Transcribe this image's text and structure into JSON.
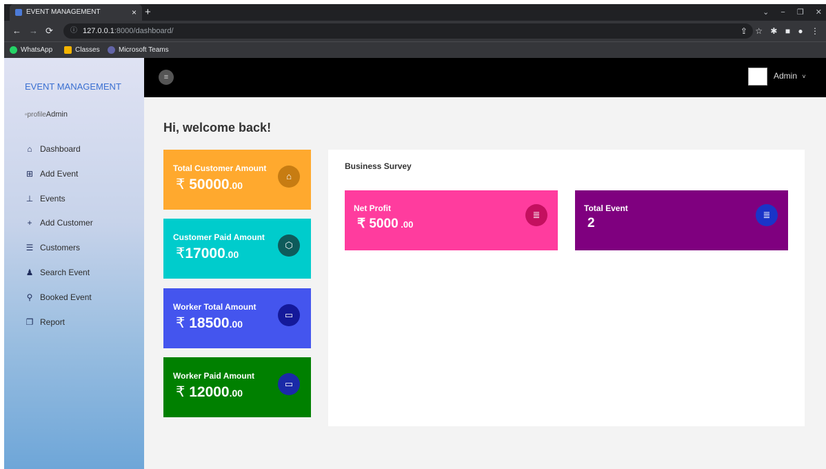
{
  "browser": {
    "tab_title": "EVENT MANAGEMENT",
    "tab_close": "×",
    "new_tab": "+",
    "url_host": "127.0.0.1",
    "url_path": ":8000/dashboard/",
    "bookmarks": [
      {
        "label": "WhatsApp",
        "icon": "whatsapp-icon",
        "color": "#25d366"
      },
      {
        "label": "Classes",
        "icon": "classroom-icon",
        "color": "#f4b400"
      },
      {
        "label": "Microsoft Teams",
        "icon": "teams-icon",
        "color": "#6264a7"
      }
    ]
  },
  "sidebar": {
    "brand": "EVENT MANAGEMENT",
    "profile_img_alt": "profile",
    "profile_name": "Admin",
    "items": [
      {
        "label": "Dashboard",
        "icon": "home-icon"
      },
      {
        "label": "Add Event",
        "icon": "plus-square-icon"
      },
      {
        "label": "Events",
        "icon": "sitemap-icon"
      },
      {
        "label": "Add Customer",
        "icon": "plus-icon"
      },
      {
        "label": "Customers",
        "icon": "tree-list-icon"
      },
      {
        "label": "Search Event",
        "icon": "user-search-icon"
      },
      {
        "label": "Booked Event",
        "icon": "bicycle-icon"
      },
      {
        "label": "Report",
        "icon": "copy-icon"
      }
    ]
  },
  "topbar": {
    "admin_label": "Admin",
    "caret": "˅"
  },
  "main": {
    "welcome": "Hi, welcome back!",
    "currency": "₹",
    "stats": [
      {
        "label": "Total Customer Amount",
        "amount": "50000",
        "decimals": ".00",
        "bg": "#ffa92e",
        "icon_bg": "#c77c12",
        "icon": "basket-icon"
      },
      {
        "label": "Customer Paid Amount",
        "amount": "17000",
        "decimals": ".00",
        "bg": "#00cccc",
        "icon_bg": "#0e5b5b",
        "icon": "cube-icon"
      },
      {
        "label": "Worker Total Amount",
        "amount": "18500",
        "decimals": ".00",
        "bg": "#4455ee",
        "icon_bg": "#14199a",
        "icon": "briefcase-icon"
      },
      {
        "label": "Worker Paid Amount",
        "amount": "12000",
        "decimals": ".00",
        "bg": "#008000",
        "icon_bg": "#1a2aa8",
        "icon": "briefcase-icon"
      }
    ],
    "survey": {
      "title": "Business Survey",
      "cards": [
        {
          "label": "Net Profit",
          "value": "₹ 5000",
          "decimals": " .00",
          "bg": "#ff3c9e",
          "icon_bg": "#c4105f",
          "icon": "list-icon"
        },
        {
          "label": "Total Event",
          "value": "2",
          "decimals": "",
          "bg": "#7f007f",
          "icon_bg": "#1a34c8",
          "icon": "list-icon"
        }
      ]
    }
  }
}
